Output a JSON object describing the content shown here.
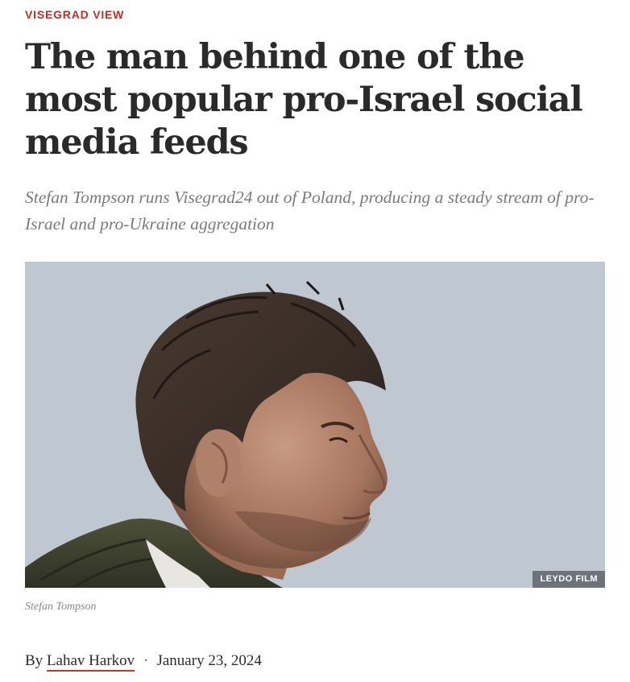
{
  "article": {
    "kicker": "VISEGRAD VIEW",
    "headline": "The man behind one of the most popular pro-Israel social media feeds",
    "dek": "Stefan Tompson runs Visegrad24 out of Poland, producing a steady stream of pro-Israel and pro-Ukraine aggregation",
    "image": {
      "credit": "LEYDO FILM",
      "caption": "Stefan Tompson"
    },
    "byline": {
      "prefix": "By",
      "author": "Lahav Harkov",
      "separator": "·",
      "date": "January 23, 2024"
    }
  },
  "colors": {
    "kicker": "#b5322a",
    "author_underline": "#c0392b",
    "headline": "#2a2a2a",
    "dek": "#7a7a7a"
  }
}
